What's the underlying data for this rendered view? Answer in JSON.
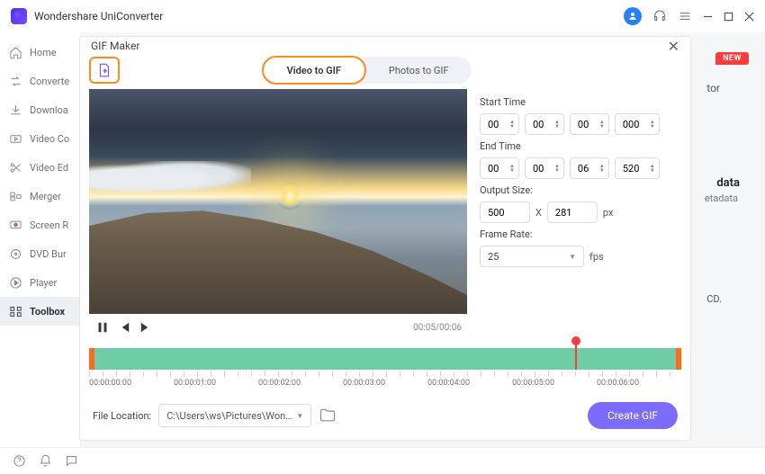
{
  "app": {
    "title": "Wondershare UniConverter",
    "new_badge": "NEW"
  },
  "sidebar": {
    "items": [
      {
        "label": "Home"
      },
      {
        "label": "Converte"
      },
      {
        "label": "Downloa"
      },
      {
        "label": "Video Co"
      },
      {
        "label": "Video Ed"
      },
      {
        "label": "Merger"
      },
      {
        "label": "Screen R"
      },
      {
        "label": "DVD Bur"
      },
      {
        "label": "Player"
      },
      {
        "label": "Toolbox"
      }
    ]
  },
  "bg": {
    "tor": "tor",
    "data": "data",
    "etadata": "etadata",
    "cd": "CD."
  },
  "modal": {
    "title": "GIF Maker",
    "tabs": {
      "video": "Video to GIF",
      "photos": "Photos to GIF"
    },
    "video_time": "00:05/00:06",
    "start_label": "Start Time",
    "end_label": "End Time",
    "start": {
      "h": "00",
      "m": "00",
      "s": "00",
      "ms": "000"
    },
    "end": {
      "h": "00",
      "m": "00",
      "s": "06",
      "ms": "520"
    },
    "output_label": "Output Size:",
    "output": {
      "w": "500",
      "h": "281",
      "unit": "px",
      "x": "X"
    },
    "framerate_label": "Frame Rate:",
    "framerate": {
      "value": "25",
      "unit": "fps"
    },
    "ticks": [
      "00:00:00:00",
      "00:00:01:00",
      "00:00:02:00",
      "00:00:03:00",
      "00:00:04:00",
      "00:00:05:00",
      "00:00:06:00"
    ],
    "marker_percent": 82,
    "file_location_label": "File Location:",
    "file_location": "C:\\Users\\ws\\Pictures\\Wonders",
    "create_btn": "Create GIF"
  }
}
